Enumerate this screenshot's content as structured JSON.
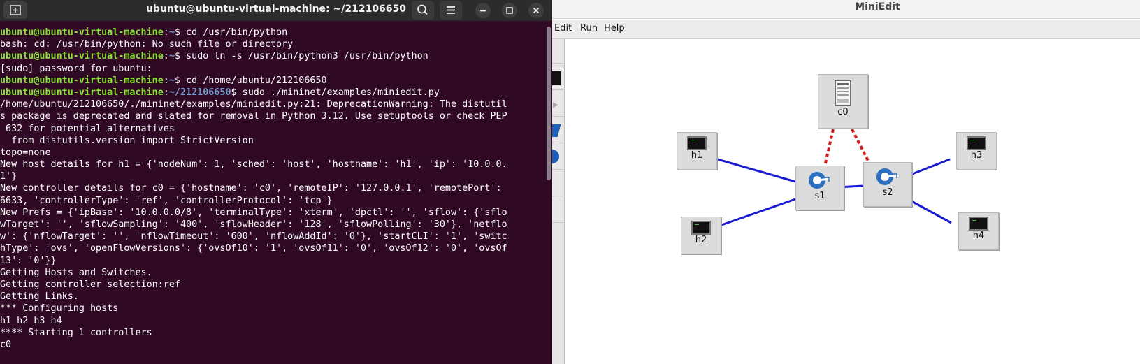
{
  "terminal": {
    "title": "ubuntu@ubuntu-virtual-machine: ~/212106650",
    "lines": [
      {
        "user": "ubuntu@ubuntu-virtual-machine",
        "path": "~",
        "cmd": "$ cd /usr/bin/python"
      },
      {
        "text": "bash: cd: /usr/bin/python: No such file or directory"
      },
      {
        "user": "ubuntu@ubuntu-virtual-machine",
        "path": "~",
        "cmd": "$ sudo ln -s /usr/bin/python3 /usr/bin/python"
      },
      {
        "text": "[sudo] password for ubuntu:"
      },
      {
        "user": "ubuntu@ubuntu-virtual-machine",
        "path": "~",
        "cmd": "$ cd /home/ubuntu/212106650"
      },
      {
        "user": "ubuntu@ubuntu-virtual-machine",
        "path": "~/212106650",
        "cmd": "$ sudo ./mininet/examples/miniedit.py"
      },
      {
        "text": "/home/ubuntu/212106650/./mininet/examples/miniedit.py:21: DeprecationWarning: The distutil"
      },
      {
        "text": "s package is deprecated and slated for removal in Python 3.12. Use setuptools or check PEP"
      },
      {
        "text": " 632 for potential alternatives"
      },
      {
        "text": "  from distutils.version import StrictVersion"
      },
      {
        "text": "topo=none"
      },
      {
        "text": "New host details for h1 = {'nodeNum': 1, 'sched': 'host', 'hostname': 'h1', 'ip': '10.0.0."
      },
      {
        "text": "1'}"
      },
      {
        "text": "New controller details for c0 = {'hostname': 'c0', 'remoteIP': '127.0.0.1', 'remotePort':"
      },
      {
        "text": "6633, 'controllerType': 'ref', 'controllerProtocol': 'tcp'}"
      },
      {
        "text": "New Prefs = {'ipBase': '10.0.0.0/8', 'terminalType': 'xterm', 'dpctl': '', 'sflow': {'sflo"
      },
      {
        "text": "wTarget': '', 'sflowSampling': '400', 'sflowHeader': '128', 'sflowPolling': '30'}, 'netflo"
      },
      {
        "text": "w': {'nflowTarget': '', 'nflowTimeout': '600', 'nflowAddId': '0'}, 'startCLI': '1', 'switc"
      },
      {
        "text": "hType': 'ovs', 'openFlowVersions': {'ovsOf10': '1', 'ovsOf11': '0', 'ovsOf12': '0', 'ovsOf"
      },
      {
        "text": "13': '0'}}"
      },
      {
        "text": "Getting Hosts and Switches."
      },
      {
        "text": "Getting controller selection:ref"
      },
      {
        "text": "Getting Links."
      },
      {
        "text": "*** Configuring hosts"
      },
      {
        "text": "h1 h2 h3 h4"
      },
      {
        "text": "**** Starting 1 controllers"
      },
      {
        "text": "c0"
      }
    ]
  },
  "miniedit": {
    "title": "MiniEdit",
    "menus": [
      "Edit",
      "Run",
      "Help"
    ],
    "nodes": {
      "c0": "c0",
      "h1": "h1",
      "h2": "h2",
      "h3": "h3",
      "h4": "h4",
      "s1": "s1",
      "s2": "s2"
    },
    "colors": {
      "link": "#1a1ad1",
      "controller_link": "#d11a1a"
    }
  }
}
